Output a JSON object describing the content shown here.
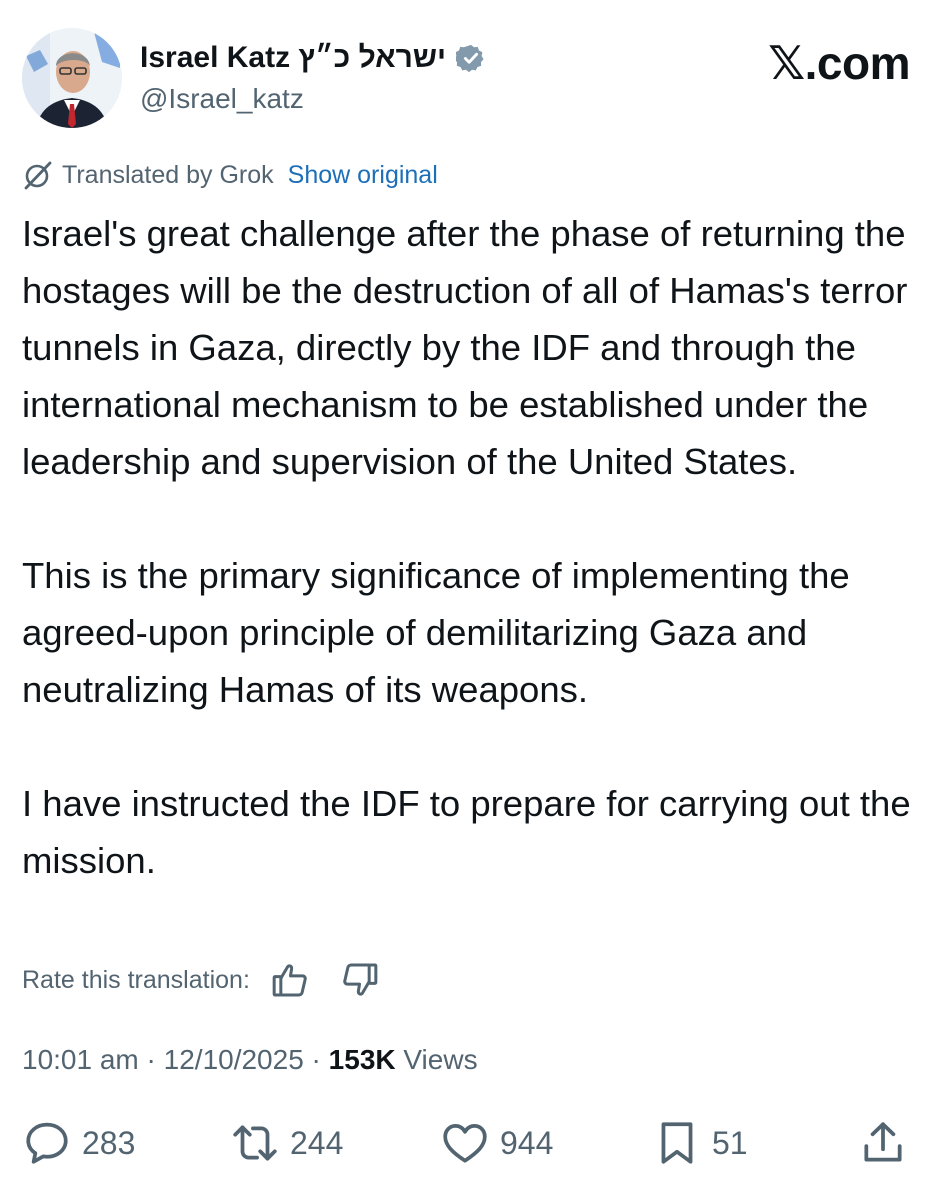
{
  "header": {
    "display_name": "Israel Katz ישראל כ״ץ",
    "handle": "@Israel_katz",
    "brand": "𝕏.com"
  },
  "translation": {
    "label": "Translated by Grok",
    "show_original": "Show original"
  },
  "post": {
    "paragraphs": [
      "Israel's great challenge after the phase of returning the hostages will be the destruction of all of Hamas's terror tunnels in Gaza, directly by the IDF and through the international mechanism to be established under the leadership and supervision of the United States.",
      "This is the primary significance of implementing the agreed-upon principle of demilitarizing Gaza and neutralizing Hamas of its weapons.",
      "I have instructed the IDF to prepare for carrying out the mission."
    ]
  },
  "rate": {
    "label": "Rate this translation:"
  },
  "meta": {
    "time": "10:01 am",
    "sep1": " · ",
    "date": "12/10/2025",
    "sep2": " · ",
    "views_count": "153K",
    "views_label": " Views"
  },
  "actions": {
    "replies": "283",
    "reposts": "244",
    "likes": "944",
    "bookmarks": "51"
  },
  "icons": {
    "verified": "verified-badge-icon",
    "grok": "grok-icon",
    "thumbs_up": "thumbs-up-icon",
    "thumbs_down": "thumbs-down-icon",
    "reply": "reply-icon",
    "repost": "repost-icon",
    "like": "heart-icon",
    "bookmark": "bookmark-icon",
    "share": "share-icon"
  },
  "colors": {
    "text": "#0f1419",
    "secondary": "#536471",
    "link": "#1d6fb8",
    "verified": "#829aab"
  }
}
